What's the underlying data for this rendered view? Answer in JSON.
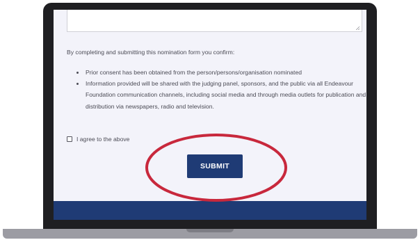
{
  "form": {
    "intro_text": "By completing and submitting this nomination form you confirm:",
    "bullets": [
      "Prior consent has been obtained from the person/persons/organisation nominated",
      "Information provided will be shared with the judging panel, sponsors, and the public via all Endeavour Foundation communication channels, including social media and through media outlets for publication and distribution via newspapers, radio and television."
    ],
    "agree_label": "I agree to the above",
    "agree_checked": false,
    "submit_label": "SUBMIT"
  },
  "colors": {
    "brand_navy": "#1f3b75",
    "highlight_red": "#c8283c",
    "screen_bg": "#f3f3fa"
  }
}
